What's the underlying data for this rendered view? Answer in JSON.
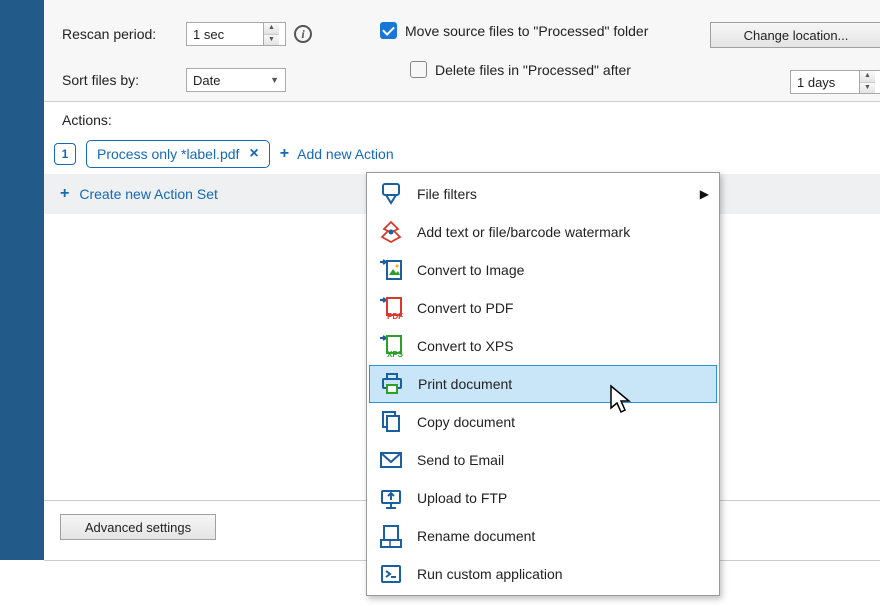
{
  "settings": {
    "rescan_label": "Rescan period:",
    "rescan_value": "1 sec",
    "sort_label": "Sort files by:",
    "sort_value": "Date",
    "move_processed_label": "Move source files to \"Processed\" folder",
    "change_location_label": "Change location...",
    "delete_after_label": "Delete files in \"Processed\" after",
    "delete_after_value": "1 days"
  },
  "actions": {
    "section_label": "Actions:",
    "badge_value": "1",
    "chip_label": "Process only *label.pdf",
    "add_new_label": "Add new Action",
    "create_set_label": "Create new Action Set",
    "advanced_label": "Advanced settings"
  },
  "menu": {
    "items": [
      {
        "label": "File filters",
        "icon": "filter-icon",
        "arrow": true
      },
      {
        "label": "Add text or file/barcode watermark",
        "icon": "watermark-icon"
      },
      {
        "label": "Convert to Image",
        "icon": "image-icon"
      },
      {
        "label": "Convert to PDF",
        "icon": "pdf-icon"
      },
      {
        "label": "Convert to XPS",
        "icon": "xps-icon"
      },
      {
        "label": "Print document",
        "icon": "print-icon",
        "highlight": true
      },
      {
        "label": "Copy document",
        "icon": "copy-icon"
      },
      {
        "label": "Send to Email",
        "icon": "email-icon"
      },
      {
        "label": "Upload to FTP",
        "icon": "ftp-icon"
      },
      {
        "label": "Rename document",
        "icon": "rename-icon"
      },
      {
        "label": "Run custom application",
        "icon": "run-icon"
      }
    ]
  }
}
